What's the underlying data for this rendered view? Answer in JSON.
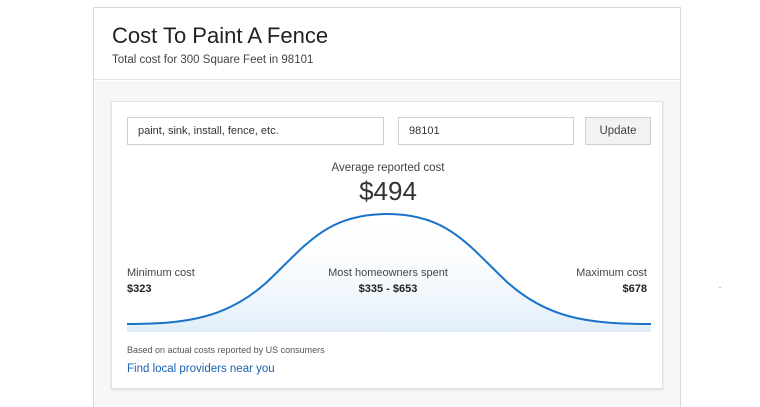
{
  "header": {
    "title": "Cost To Paint A Fence",
    "subtitle": "Total cost for 300 Square Feet in 98101"
  },
  "form": {
    "search_value": "paint, sink, install, fence, etc.",
    "zip_value": "98101",
    "update_label": "Update"
  },
  "cost": {
    "average_label": "Average reported cost",
    "average_value": "$494",
    "minimum_label": "Minimum cost",
    "minimum_value": "$323",
    "most_label": "Most homeowners spent",
    "most_value": "$335 - $653",
    "maximum_label": "Maximum cost",
    "maximum_value": "$678"
  },
  "footer": {
    "note": "Based on actual costs reported by US consumers",
    "link_text": "Find local providers near you"
  },
  "colors": {
    "curve": "#1a73c8",
    "link": "#1a62b0"
  }
}
